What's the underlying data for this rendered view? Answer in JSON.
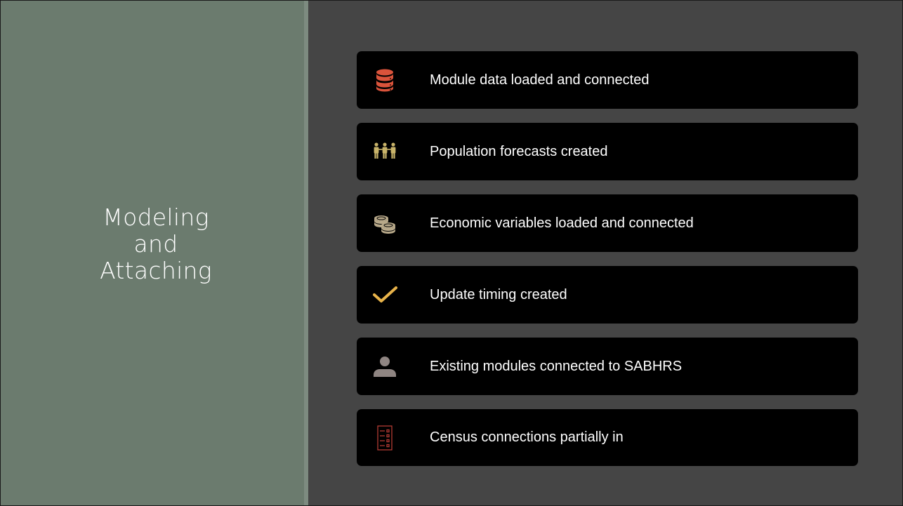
{
  "slide": {
    "title_lines": [
      "Modeling",
      "and",
      "Attaching"
    ]
  },
  "items": [
    {
      "label": "Module data loaded and connected",
      "icon": "database-icon",
      "icon_color": "#d9533b"
    },
    {
      "label": "Population forecasts created",
      "icon": "people-group-icon",
      "icon_color": "#c9b46a"
    },
    {
      "label": "Economic variables loaded and connected",
      "icon": "coins-icon",
      "icon_color": "#b8a98a"
    },
    {
      "label": "Update timing created",
      "icon": "checkmark-icon",
      "icon_color": "#e8b34a"
    },
    {
      "label": "Existing modules connected to SABHRS",
      "icon": "person-icon",
      "icon_color": "#8f8582"
    },
    {
      "label": "Census connections partially in",
      "icon": "checklist-icon",
      "icon_color": "#b33a33"
    }
  ],
  "colors": {
    "left_panel": "#6b7b6e",
    "right_panel": "#454545",
    "card_background": "#000000",
    "text": "#ffffff"
  }
}
